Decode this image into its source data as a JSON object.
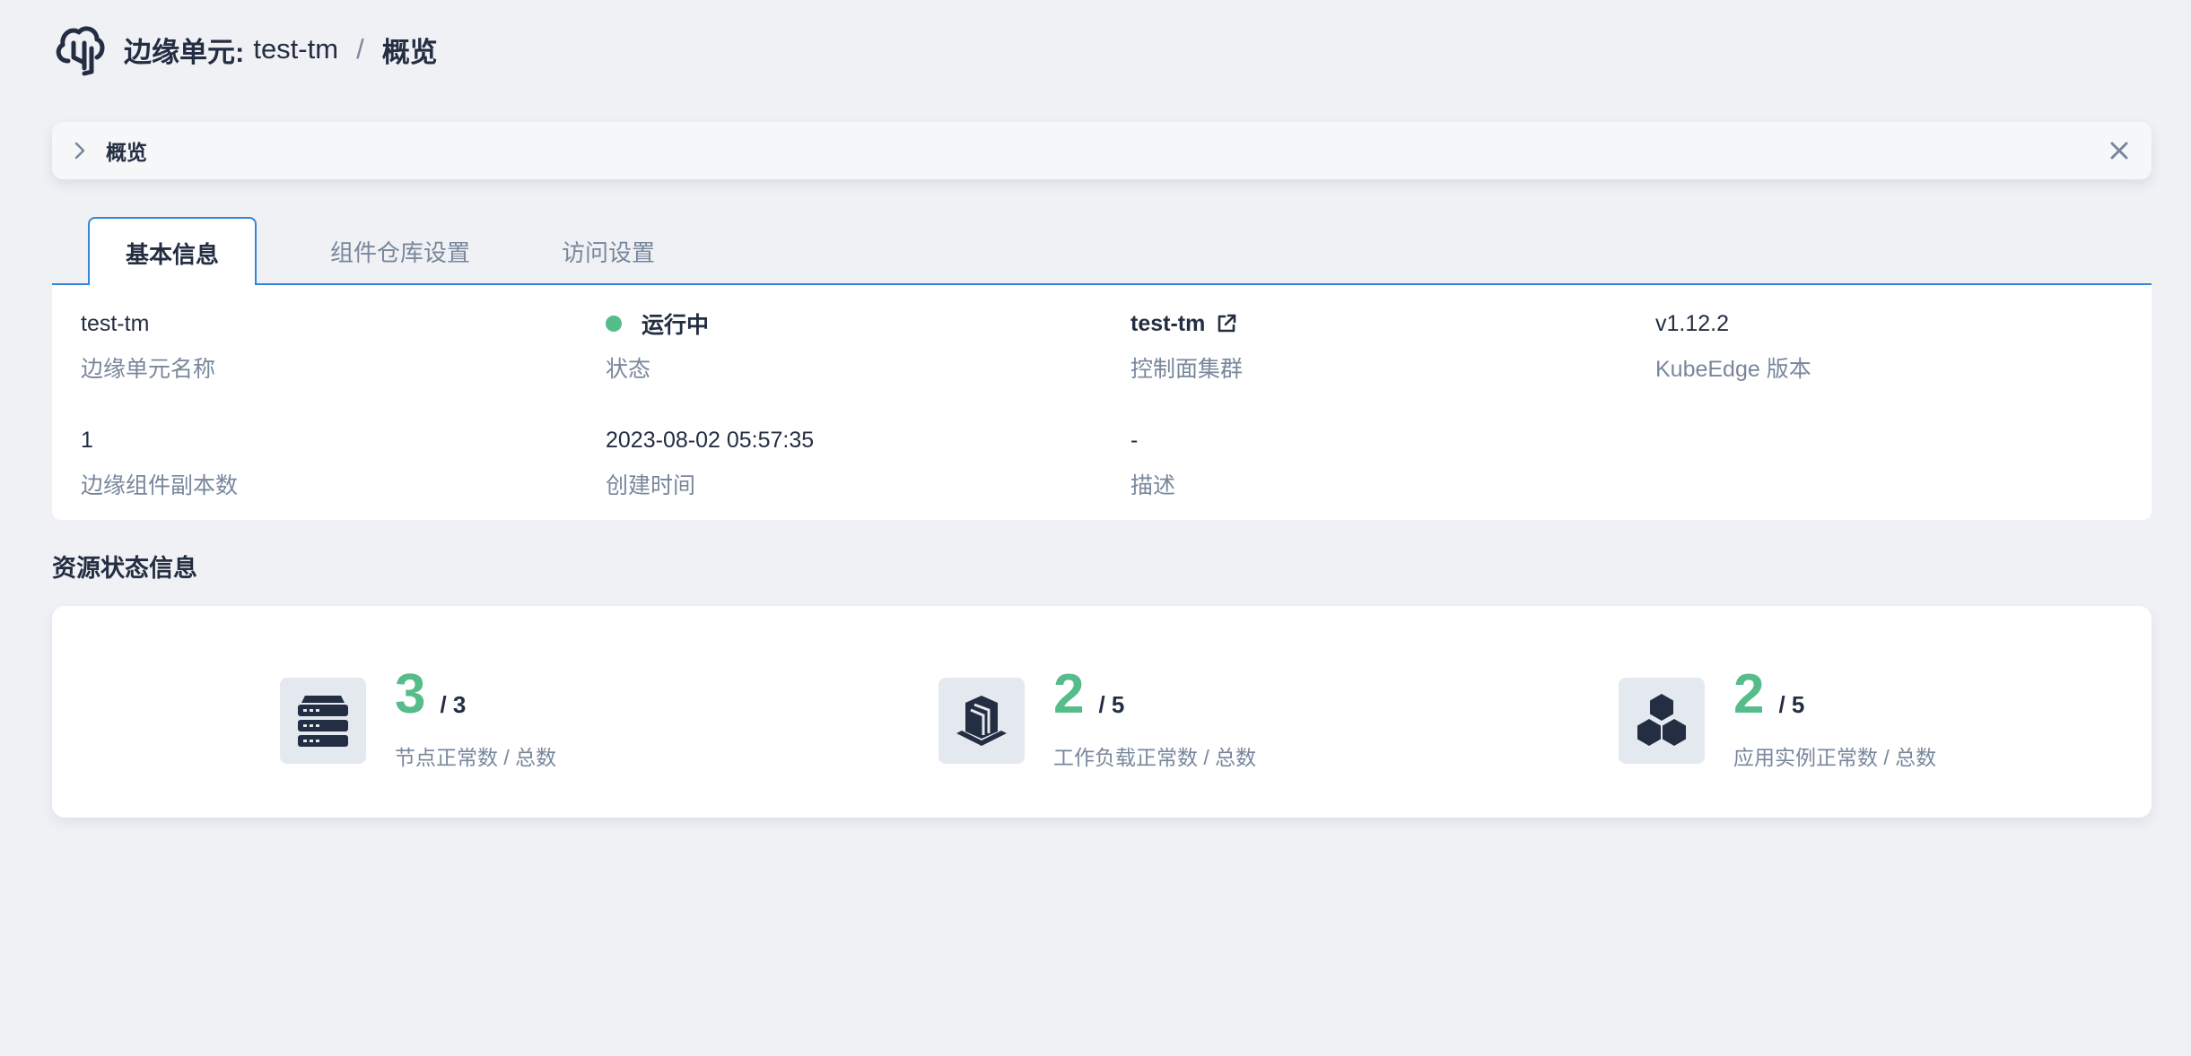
{
  "header": {
    "prefix": "边缘单元:",
    "unit_name": "test-tm",
    "separator": "/",
    "current": "概览"
  },
  "collapse": {
    "title": "概览"
  },
  "tabs": [
    {
      "label": "基本信息",
      "active": true
    },
    {
      "label": "组件仓库设置",
      "active": false
    },
    {
      "label": "访问设置",
      "active": false
    }
  ],
  "info": {
    "name": {
      "value": "test-tm",
      "label": "边缘单元名称"
    },
    "status": {
      "value": "运行中",
      "label": "状态",
      "color": "#55bc8a"
    },
    "cluster": {
      "value": "test-tm",
      "label": "控制面集群"
    },
    "version": {
      "value": "v1.12.2",
      "label": "KubeEdge 版本"
    },
    "replicas": {
      "value": "1",
      "label": "边缘组件副本数"
    },
    "created": {
      "value": "2023-08-02 05:57:35",
      "label": "创建时间"
    },
    "description": {
      "value": "-",
      "label": "描述"
    }
  },
  "resources": {
    "title": "资源状态信息",
    "stats": [
      {
        "icon": "server-icon",
        "ok": "3",
        "total": "/ 3",
        "label": "节点正常数 / 总数"
      },
      {
        "icon": "workload-icon",
        "ok": "2",
        "total": "/ 5",
        "label": "工作负载正常数 / 总数"
      },
      {
        "icon": "app-instance-icon",
        "ok": "2",
        "total": "/ 5",
        "label": "应用实例正常数 / 总数"
      }
    ]
  },
  "colors": {
    "accent": "#3385d6",
    "success": "#55bc8a",
    "text": "#242e42",
    "muted": "#79879c",
    "background": "#eff1f5"
  }
}
